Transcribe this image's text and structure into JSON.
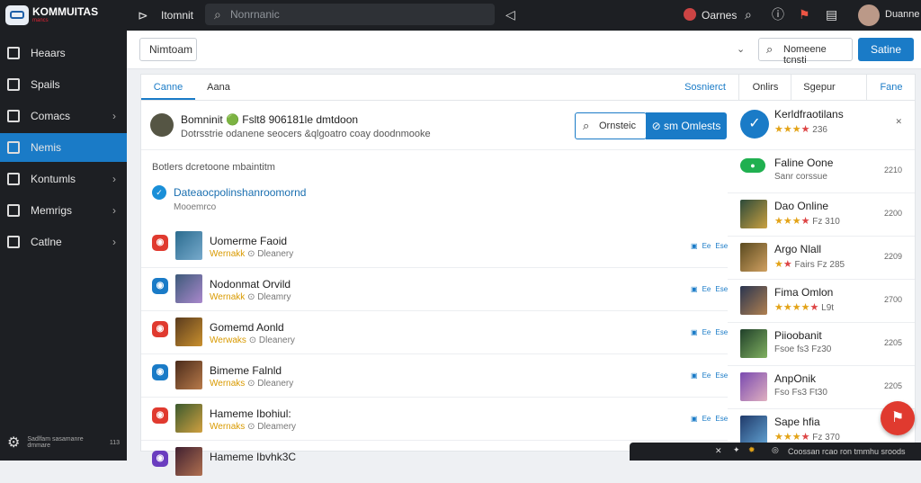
{
  "topbar": {
    "logo_text": "KOMMUITAS",
    "logo_sub": "mancs",
    "search_placeholder": "Nonrnanic",
    "tab_label": "Itomnit",
    "user_name": "Oarnes",
    "profile_name": "Duanne"
  },
  "sidebar": {
    "items": [
      {
        "label": "Heaars",
        "icon": "page-icon",
        "chevron": false
      },
      {
        "label": "Spails",
        "icon": "document-icon",
        "chevron": false
      },
      {
        "label": "Comacs",
        "icon": "wrench-icon",
        "chevron": true
      },
      {
        "label": "Nemis",
        "icon": "store-icon",
        "chevron": false,
        "active": true
      },
      {
        "label": "Kontumls",
        "icon": "check-icon",
        "chevron": true
      },
      {
        "label": "Memrigs",
        "icon": "message-icon",
        "chevron": true
      },
      {
        "label": "Catlne",
        "icon": "layout-icon",
        "chevron": true
      }
    ],
    "footer_text": "Sadlfam sasamanre dmmare",
    "footer_count": "113"
  },
  "header": {
    "dropdown_value": "Nimtoam",
    "search_button": "Nomeene tcnsti",
    "primary_button": "Satine"
  },
  "tabs": {
    "left": [
      "Canne",
      "Aana"
    ],
    "right": [
      "Sosnierct",
      "Onlirs",
      "Sgepur",
      "Fane"
    ]
  },
  "featured": {
    "title": "Bomninit 🟢 Fslt8 906181le dmtdoon",
    "desc": "Dotrsstrie odanene seocers &qlgoatro coay doodnmooke",
    "search_btn": "Ornsteic",
    "primary_btn": "sm Omlests"
  },
  "section_heading": "Botlers dcretoone mbaintitm",
  "highlight_link": "Dateaocpolinshanroomornd",
  "highlight_sub": "Mooemrco",
  "rows": [
    {
      "name": "Uomerme Faoid",
      "sub_a": "Wernakk",
      "sub_b": "Dleanery",
      "acts": [
        "▣",
        "Ee",
        "Ese"
      ],
      "badge": "red",
      "thumb": "a"
    },
    {
      "name": "Nodonmat Orvild",
      "sub_a": "Wernakk",
      "sub_b": "Dleamry",
      "acts": [
        "▣",
        "Ee",
        "Ese"
      ],
      "badge": "blue",
      "thumb": "b"
    },
    {
      "name": "Gomemd Aonld",
      "sub_a": "Werwaks",
      "sub_b": "Dleanery",
      "acts": [
        "▣",
        "Ee",
        "Ese"
      ],
      "badge": "red",
      "thumb": "c"
    },
    {
      "name": "Bimeme Falnld",
      "sub_a": "Wernaks",
      "sub_b": "Dleanery",
      "acts": [
        "▣",
        "Ee",
        "Ese"
      ],
      "badge": "blue",
      "thumb": "d"
    },
    {
      "name": "Hameme Ibohiul:",
      "sub_a": "Wernaks",
      "sub_b": "Dleamery",
      "acts": [
        "▣",
        "Ee",
        "Ese"
      ],
      "badge": "red",
      "thumb": "e"
    },
    {
      "name": "Hameme Ibvhk3C",
      "sub_a": "",
      "sub_b": "",
      "acts": [],
      "badge": "purple",
      "thumb": "f"
    }
  ],
  "right_items": [
    {
      "title": "Kerldfraotilans",
      "rating_text": "236",
      "stars": 3,
      "count": "✕",
      "thumb": "check"
    },
    {
      "title": "Faline Oone",
      "rating_text": "Sanr corssue",
      "stars": 0,
      "count": "2210",
      "thumb": "green"
    },
    {
      "title": "Dao Online",
      "rating_text": "Fz 310",
      "stars": 3,
      "count": "2200",
      "thumb": "g1"
    },
    {
      "title": "Argo Nlall",
      "rating_text": "Fairs  Fz 285",
      "stars": 1,
      "count": "2209",
      "thumb": "g2"
    },
    {
      "title": "Fima Omlon",
      "rating_text": "L9t",
      "stars": 4,
      "count": "2700",
      "thumb": "g3"
    },
    {
      "title": "Piioobanit",
      "rating_text": "Fsoe  fs3  Fz30",
      "stars": 0,
      "count": "2205",
      "thumb": "g4"
    },
    {
      "title": "AnpOnik",
      "rating_text": "Fso  Fs3  Ft30",
      "stars": 0,
      "count": "2205",
      "thumb": "g5"
    },
    {
      "title": "Sape hfia",
      "rating_text": "Fz 370",
      "stars": 3,
      "count": "",
      "thumb": "g6"
    }
  ],
  "toast": {
    "text": "Coossan rcao ron tmmhu sroods"
  }
}
